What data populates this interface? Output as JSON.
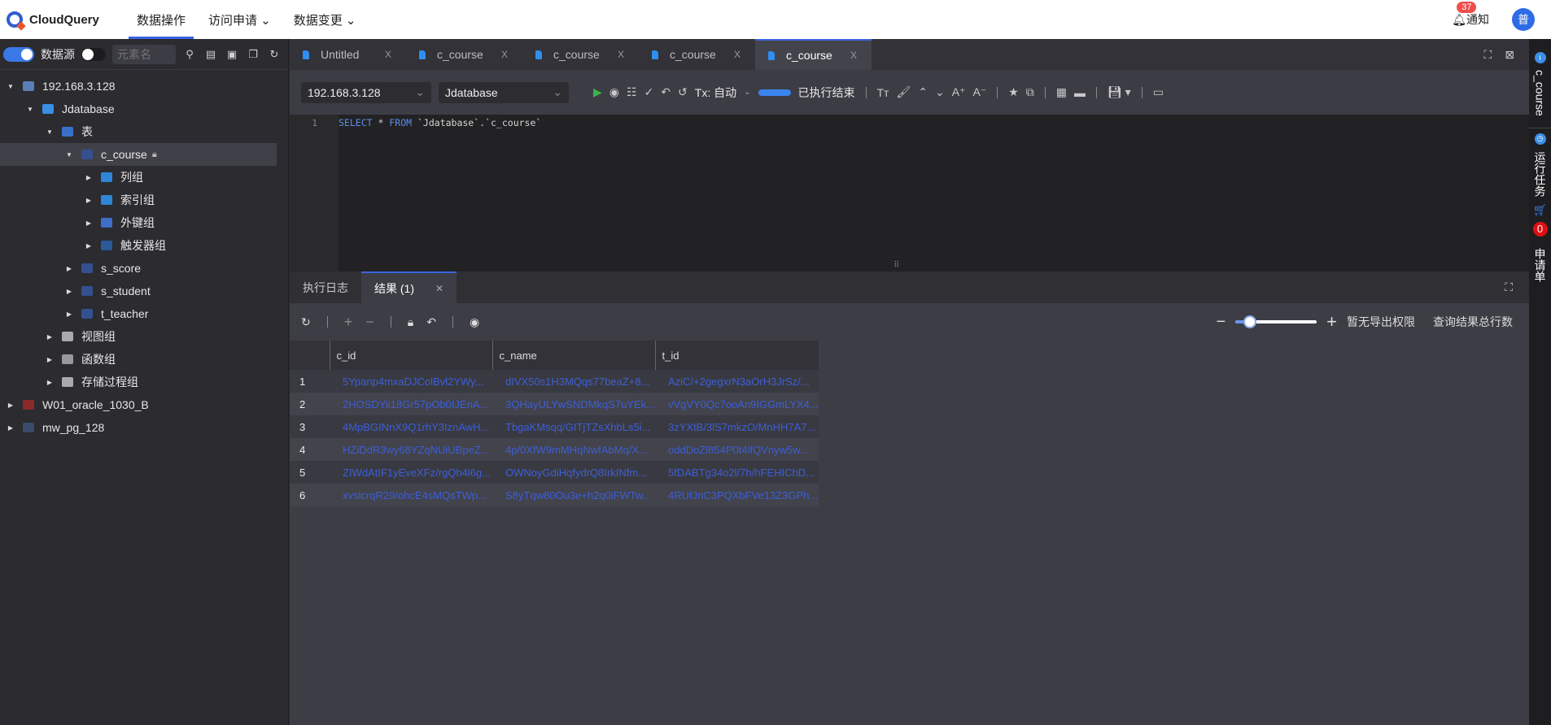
{
  "header": {
    "app_name": "CloudQuery",
    "nav": [
      {
        "label": "数据操作",
        "active": true
      },
      {
        "label": "访问申请 ⌄"
      },
      {
        "label": "数据变更 ⌄"
      }
    ],
    "notice_count": "37",
    "notice_label": "通知",
    "avatar": "普"
  },
  "sidebar": {
    "toggle_label": "数据源",
    "search_placeholder": "元素名",
    "tree": [
      {
        "level": 0,
        "label": "192.168.3.128",
        "icon": "mysql-icon",
        "color": "#5a7fb8",
        "expanded": true
      },
      {
        "level": 1,
        "label": "Jdatabase",
        "icon": "database-icon",
        "color": "#3a8ee6",
        "expanded": true
      },
      {
        "level": 2,
        "label": "表",
        "icon": "table-icon",
        "color": "#3a6fc8",
        "expanded": true
      },
      {
        "level": 3,
        "label": "c_course",
        "icon": "table-icon",
        "color": "#34508f",
        "expanded": true,
        "selected": true,
        "locked": true
      },
      {
        "level": 4,
        "label": "列组",
        "icon": "columns-icon",
        "color": "#2f86d8"
      },
      {
        "level": 4,
        "label": "索引组",
        "icon": "index-icon",
        "color": "#2f86d8"
      },
      {
        "level": 4,
        "label": "外键组",
        "icon": "foreign-key-icon",
        "color": "#3f6ec8"
      },
      {
        "level": 4,
        "label": "触发器组",
        "icon": "trigger-icon",
        "color": "#2a5a9a"
      },
      {
        "level": 3,
        "label": "s_score",
        "icon": "table-icon",
        "color": "#34508f"
      },
      {
        "level": 3,
        "label": "s_student",
        "icon": "table-icon",
        "color": "#34508f"
      },
      {
        "level": 3,
        "label": "t_teacher",
        "icon": "table-icon",
        "color": "#34508f"
      },
      {
        "level": 2,
        "label": "视图组",
        "icon": "view-icon",
        "color": "#aaaaaa"
      },
      {
        "level": 2,
        "label": "函数组",
        "icon": "function-icon",
        "color": "#999999"
      },
      {
        "level": 2,
        "label": "存储过程组",
        "icon": "procedure-icon",
        "color": "#aaaaaa"
      },
      {
        "level": 0,
        "label": "W01_oracle_1030_B",
        "icon": "oracle-icon",
        "color": "#8a2a2a"
      },
      {
        "level": 0,
        "label": "mw_pg_128",
        "icon": "postgres-icon",
        "color": "#3a4a6a"
      }
    ]
  },
  "tabs": [
    {
      "label": "Untitled"
    },
    {
      "label": "c_course"
    },
    {
      "label": "c_course"
    },
    {
      "label": "c_course"
    },
    {
      "label": "c_course",
      "active": true
    }
  ],
  "toolbar": {
    "connection": "192.168.3.128",
    "database": "Jdatabase",
    "tx_label": "Tx: 自动",
    "status": "已执行结束"
  },
  "editor": {
    "line": "1",
    "keyword1": "SELECT",
    "star": "*",
    "keyword2": "FROM",
    "target": "`Jdatabase`.`c_course`"
  },
  "result_tabs": [
    {
      "label": "执行日志"
    },
    {
      "label": "结果 (1)",
      "active": true
    }
  ],
  "result_toolbar": {
    "zoom_level": 0.18,
    "export_label": "暂无导出权限",
    "count_label": "查询结果总行数"
  },
  "table": {
    "columns": [
      "c_id",
      "c_name",
      "t_id"
    ],
    "rows": [
      [
        "1",
        "5Ypanp4mxaDJColBvl2YWy...",
        "dIVX50s1H3MQqs77beaZ+8...",
        "AziC/+2gegxrN3aOrH3JrSz/..."
      ],
      [
        "2",
        "2HOSDYii18Gr57pOb0IJEnA...",
        "3QHayULYwSNDMkqS7uYEk...",
        "vVgVY0Qc7ooAn9IGGmLYX4..."
      ],
      [
        "3",
        "4MpBGINnX9Q1rhY3IznAwH...",
        "TbgaKMsqq/GITjTZsXhbLs5i...",
        "3zYXtB/3lS7mkzO/MnHH7A7..."
      ],
      [
        "4",
        "HZiDdR3wy68YZqNUiUBpeZ...",
        "4p/0XfW9mMHqNwfAbMq/X...",
        "oddDoZl854P0t4lfQVnyw5w..."
      ],
      [
        "5",
        "ZIWdAtIF1yEveXFz/rgQh4l6g...",
        "OWNoyGdiHqfydrQ8IrkINfm...",
        "5fDABTg34o2l/7h/hFEHIChD..."
      ],
      [
        "6",
        "xvslcrqR29/ohcE4sMQsTWp...",
        "S8yTqw80Ou3e+h2q0iFWTw...",
        "4RUfJnC3PQXbFVe13Z3GPh..."
      ]
    ]
  },
  "rightbar": {
    "object": "c_course",
    "tasks": "运行任务",
    "cart_count": "0",
    "apply": "申请单"
  }
}
